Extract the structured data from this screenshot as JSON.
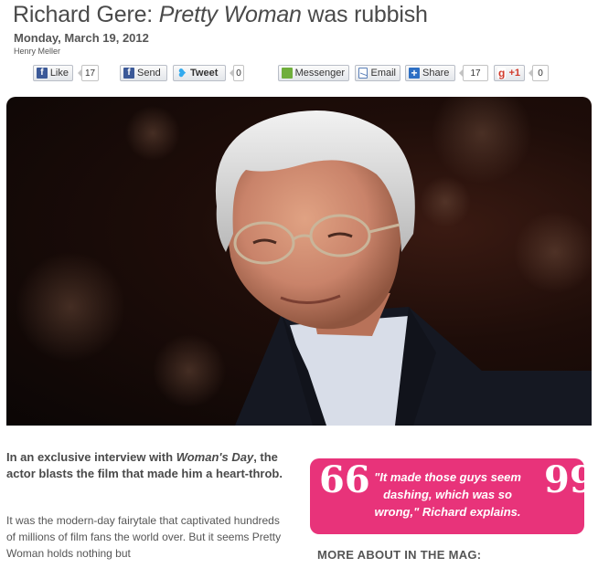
{
  "article": {
    "title_prefix": "Richard Gere: ",
    "title_italic": "Pretty Woman",
    "title_suffix": " was rubbish",
    "date": "Monday, March 19, 2012",
    "author": "Henry Meller"
  },
  "share_bar": {
    "like_label": "Like",
    "like_count": "17",
    "send_label": "Send",
    "tweet_label": "Tweet",
    "tweet_count": "0",
    "messenger_label": "Messenger",
    "email_label": "Email",
    "share_label": "Share",
    "share_count": "17",
    "gplus_label": "+1",
    "gplus_count": "0",
    "icons": [
      "facebook-icon",
      "twitter-icon",
      "messenger-icon",
      "email-icon",
      "share-plus-icon",
      "google-plus-icon"
    ]
  },
  "hero_image": {
    "alt": "Portrait photo of Richard Gere"
  },
  "body": {
    "intro_prefix": "In an exclusive interview with ",
    "intro_italic": "Woman's Day",
    "intro_suffix": ", the actor blasts the film that made him a heart-throb.",
    "paragraph": "It was the modern-day fairytale that captivated hundreds of millions of film fans the world over. But it seems Pretty Woman holds nothing but"
  },
  "pull_quote": {
    "text": "\"It made those guys seem dashing, which was so wrong,\" Richard explains.",
    "open_mark": "66",
    "close_mark": "99"
  },
  "sidebar": {
    "more_heading": "MORE ABOUT IN THE MAG:"
  },
  "colors": {
    "accent_pink": "#e8337a",
    "facebook_blue": "#3b5998",
    "heading_gray": "#4a4a4a"
  }
}
